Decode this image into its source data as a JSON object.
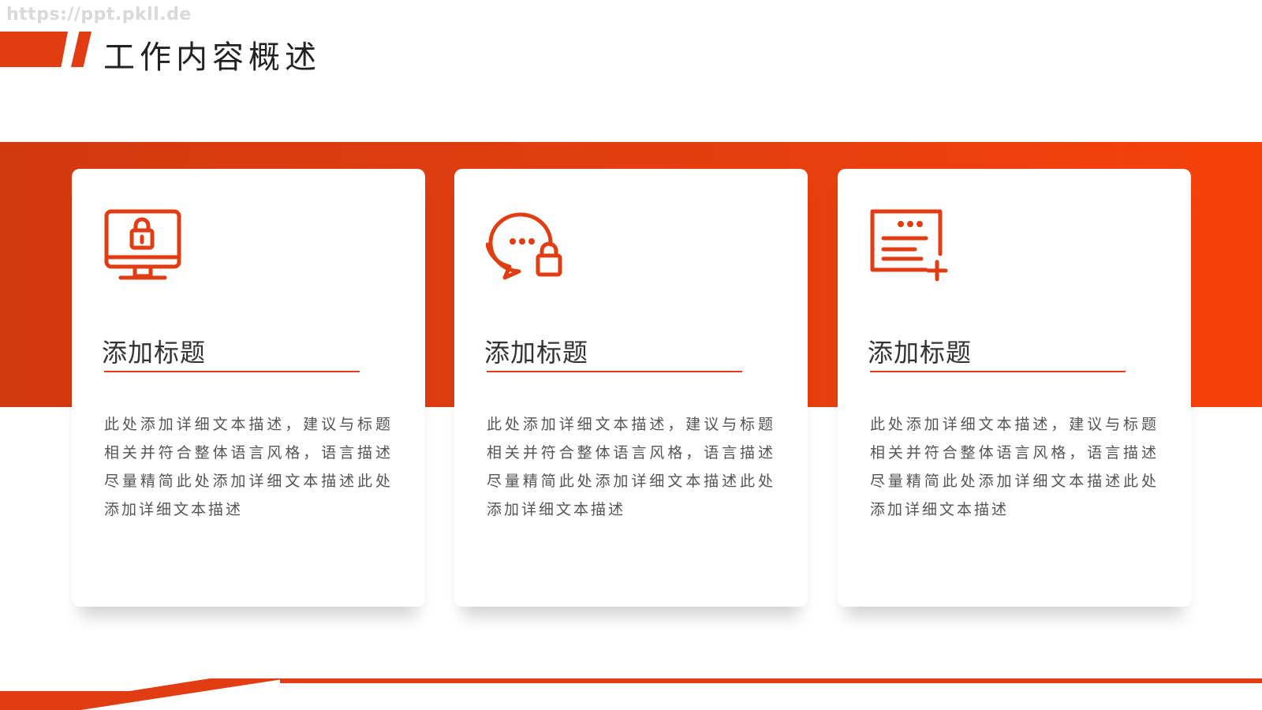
{
  "watermark": "https://ppt.pkll.de",
  "header": {
    "title": "工作内容概述"
  },
  "colors": {
    "accent": "#e23d12",
    "accent_light": "#f5420a",
    "text": "#333333"
  },
  "cards": [
    {
      "icon": "monitor-lock-icon",
      "title": "添加标题",
      "description": "此处添加详细文本描述，建议与标题相关并符合整体语言风格，语言描述尽量精简此处添加详细文本描述此处添加详细文本描述"
    },
    {
      "icon": "chat-lock-icon",
      "title": "添加标题",
      "description": "此处添加详细文本描述，建议与标题相关并符合整体语言风格，语言描述尽量精简此处添加详细文本描述此处添加详细文本描述"
    },
    {
      "icon": "document-add-icon",
      "title": "添加标题",
      "description": "此处添加详细文本描述，建议与标题相关并符合整体语言风格，语言描述尽量精简此处添加详细文本描述此处添加详细文本描述"
    }
  ]
}
